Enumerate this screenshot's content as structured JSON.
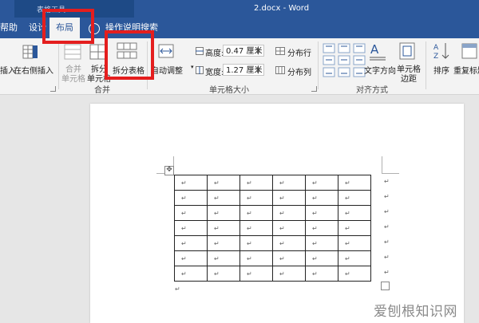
{
  "window": {
    "context_group": "表格工具",
    "document_title": "2.docx  -  Word"
  },
  "tabs": [
    {
      "label": "帮助"
    },
    {
      "label": "设计"
    },
    {
      "label": "布局",
      "active": true
    },
    {
      "label": "操作说明搜索"
    }
  ],
  "ribbon": {
    "insert": {
      "insert_label": "插入",
      "insert_right_label": "在右侧插入"
    },
    "merge": {
      "merge_cells_line1": "合并",
      "merge_cells_line2": "单元格",
      "split_cells_line1": "拆分",
      "split_cells_line2": "单元格",
      "split_table": "拆分表格",
      "group_label": "合并"
    },
    "cell_size": {
      "autofit": "自动调整",
      "height_label": "高度:",
      "height_value": "0.47 厘米",
      "width_label": "宽度:",
      "width_value": "1.27 厘米",
      "distribute_rows": "分布行",
      "distribute_cols": "分布列",
      "group_label": "单元格大小"
    },
    "alignment": {
      "text_direction": "文字方向",
      "cell_margins_line1": "单元格",
      "cell_margins_line2": "边距",
      "group_label": "对齐方式"
    },
    "data": {
      "sort": "排序",
      "repeat_header": "重复标题"
    }
  },
  "document": {
    "table": {
      "rows": 7,
      "cols": 6,
      "cell_mark": "↵"
    },
    "paragraph_mark": "↵"
  },
  "watermark": "爱刨根知识网",
  "colors": {
    "accent": "#2b579a",
    "highlight": "#e41e1e"
  }
}
